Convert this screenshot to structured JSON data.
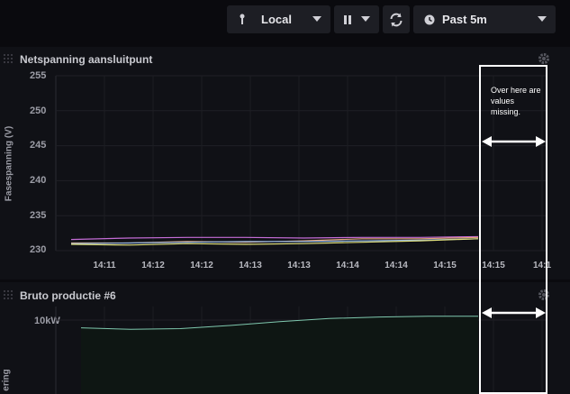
{
  "toolbar": {
    "timezone_label": "Local",
    "range_label": "Past 5m"
  },
  "panel1": {
    "title": "Netspanning aansluitpunt",
    "y_axis_label": "Fasespanning (V)",
    "y_ticks": [
      "255",
      "250",
      "245",
      "240",
      "235",
      "230"
    ],
    "x_ticks": [
      "14:11",
      "14:12",
      "14:12",
      "14:13",
      "14:13",
      "14:14",
      "14:14",
      "14:15",
      "14:15",
      "14:1"
    ]
  },
  "panel2": {
    "title": "Bruto productie #6",
    "y_tick": "10kW",
    "y_axis_label_partial": "ering"
  },
  "annotation": {
    "note": "Over here are values missing."
  },
  "colors": {
    "background": "#0a0a0e",
    "panel": "#101116",
    "series1": "#c46cd6",
    "series2": "#e4a67a",
    "series3": "#8bb0e0",
    "series4": "#e1e17e",
    "production": "#7fc8ae"
  },
  "chart_data": [
    {
      "type": "line",
      "title": "Netspanning aansluitpunt",
      "ylabel": "Fasespanning (V)",
      "ylim": [
        230,
        255
      ],
      "x": [
        "14:11",
        "14:12",
        "14:12",
        "14:13",
        "14:13",
        "14:14",
        "14:14",
        "14:15"
      ],
      "series": [
        {
          "values": [
            231.6,
            231.8,
            231.9,
            231.9,
            231.8,
            231.9,
            231.9,
            232.0
          ]
        },
        {
          "values": [
            231.1,
            231.1,
            231.3,
            231.2,
            231.4,
            231.7,
            231.7,
            231.9
          ]
        },
        {
          "values": [
            231.0,
            231.1,
            231.2,
            231.3,
            231.3,
            231.4,
            231.5,
            231.7
          ]
        },
        {
          "values": [
            230.9,
            230.8,
            231.0,
            230.9,
            231.0,
            231.2,
            231.4,
            231.7
          ]
        }
      ]
    },
    {
      "type": "area",
      "title": "Bruto productie #6",
      "y_tick": "10kW",
      "values": [
        0.9,
        0.88,
        0.89,
        0.93,
        0.98,
        1.02,
        1.04,
        1.05,
        1.05
      ]
    }
  ]
}
